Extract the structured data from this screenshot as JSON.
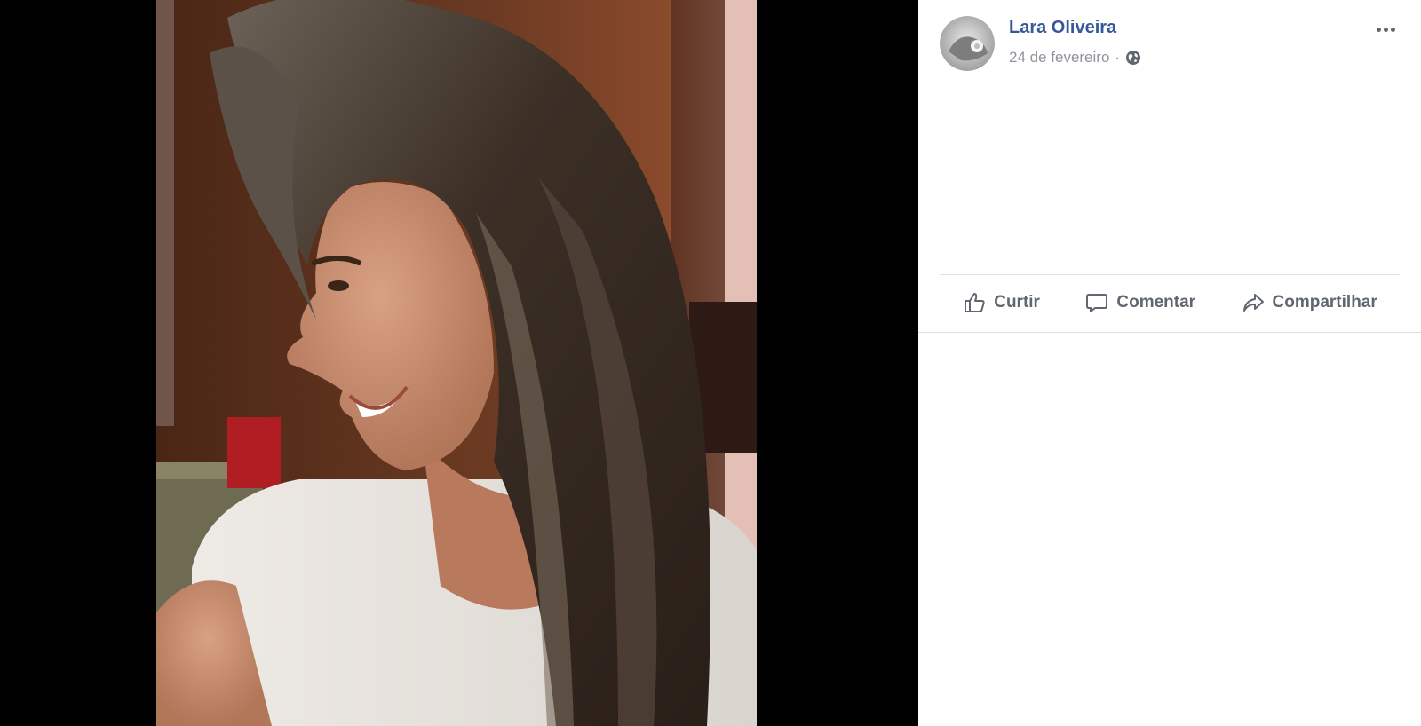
{
  "post": {
    "author_name": "Lara Oliveira",
    "date": "24 de fevereiro",
    "separator": "·",
    "audience_icon": "globe-icon",
    "options_icon": "more-options-icon"
  },
  "actions": {
    "like_label": "Curtir",
    "comment_label": "Comentar",
    "share_label": "Compartilhar",
    "like_icon": "thumbs-up-icon",
    "comment_icon": "speech-bubble-icon",
    "share_icon": "share-arrow-icon"
  },
  "colors": {
    "link_blue": "#365899",
    "meta_gray": "#90949c",
    "action_gray": "#606770",
    "viewer_background": "#000000",
    "divider": "#dddfe2"
  }
}
